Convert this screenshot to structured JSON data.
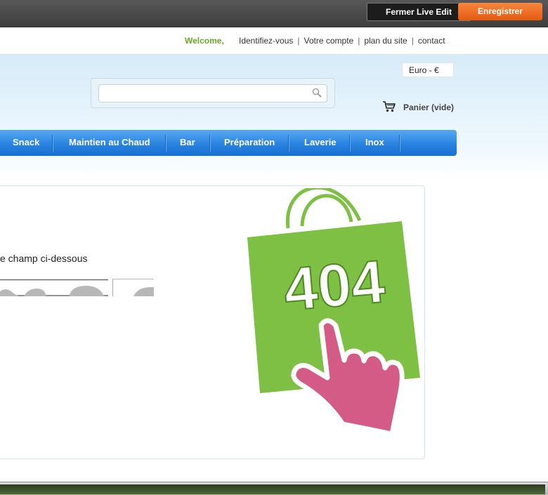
{
  "topbar": {
    "close_label": "Fermer Live Edit",
    "save_label": "Enregistrer"
  },
  "header": {
    "welcome": "Welcome,",
    "links": [
      "Identifiez-vous",
      "Votre compte",
      "plan du site",
      "contact"
    ],
    "currency": "Euro - €",
    "cart_label": "Panier (vide)",
    "search": {
      "value": "",
      "placeholder": ""
    }
  },
  "menu": {
    "items": [
      "Snack",
      "Maintien au Chaud",
      "Bar",
      "Préparation",
      "Laverie",
      "Inox"
    ]
  },
  "content": {
    "instruction": "e champ ci-dessous",
    "graphic_text": "404"
  },
  "colors": {
    "accent_green": "#7dc043",
    "accent_pink": "#d45b85",
    "menu_blue": "#2a83e0",
    "save_orange": "#e35a10"
  }
}
